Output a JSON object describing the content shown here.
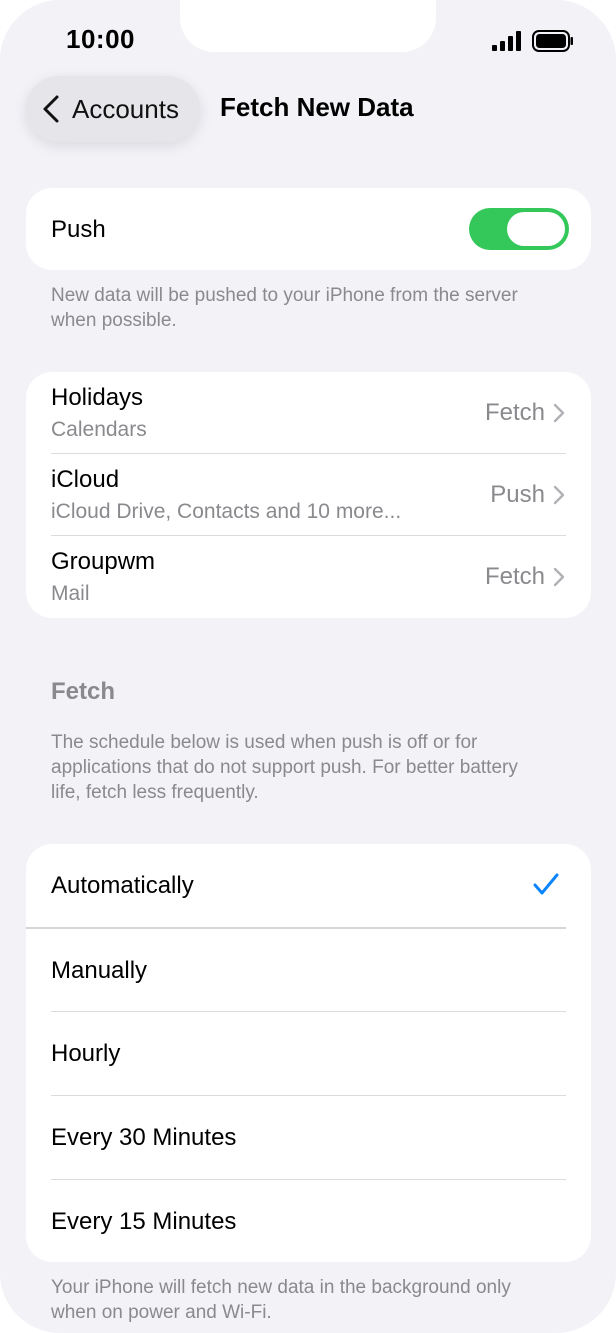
{
  "status_bar": {
    "time": "10:00",
    "signal_icon": "cellular-signal-icon",
    "battery_icon": "battery-full-icon"
  },
  "nav": {
    "back_label": "Accounts",
    "back_icon": "chevron-left-icon",
    "title": "Fetch New Data"
  },
  "push": {
    "label": "Push",
    "enabled": true,
    "toggle_color": "#34c759",
    "footnote": "New data will be pushed to your iPhone from the server when possible."
  },
  "accounts": [
    {
      "name": "Holidays",
      "detail": "Calendars",
      "mode": "Fetch"
    },
    {
      "name": "iCloud",
      "detail": "iCloud Drive, Contacts and 10 more...",
      "mode": "Push"
    },
    {
      "name": "Groupwm",
      "detail": "Mail",
      "mode": "Fetch"
    }
  ],
  "fetch_section": {
    "header": "Fetch",
    "description": "The schedule below is used when push is off or for applications that do not support push. For better battery life, fetch less frequently."
  },
  "schedule": {
    "options": [
      "Automatically",
      "Manually",
      "Hourly",
      "Every 30 Minutes",
      "Every 15 Minutes"
    ],
    "selected": "Automatically",
    "check_color": "#0a84ff",
    "footnote": "Your iPhone will fetch new data in the background only when on power and Wi-Fi."
  }
}
